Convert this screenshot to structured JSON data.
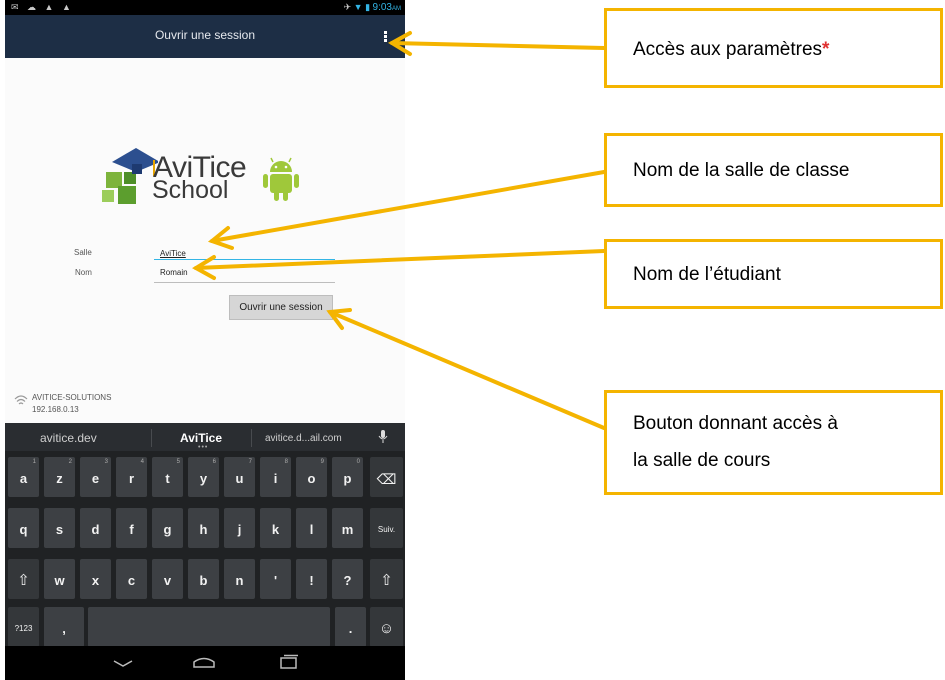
{
  "status_bar": {
    "time": "9:03",
    "ampm": "AM"
  },
  "action_bar": {
    "title": "Ouvrir une session"
  },
  "logo": {
    "line1": "AviTice",
    "line2": "School"
  },
  "form": {
    "salle_label": "Salle",
    "salle_value": "AviTice",
    "nom_label": "Nom",
    "nom_value": "Romain",
    "login_button": "Ouvrir une session"
  },
  "server": {
    "name": "AVITICE-SOLUTIONS",
    "ip": "192.168.0.13"
  },
  "keyboard": {
    "suggestions": [
      "avitice.dev",
      "AviTice",
      "avitice.d...ail.com"
    ],
    "row1": [
      [
        "a",
        "1"
      ],
      [
        "z",
        "2"
      ],
      [
        "e",
        "3"
      ],
      [
        "r",
        "4"
      ],
      [
        "t",
        "5"
      ],
      [
        "y",
        "6"
      ],
      [
        "u",
        "7"
      ],
      [
        "i",
        "8"
      ],
      [
        "o",
        "9"
      ],
      [
        "p",
        "0"
      ]
    ],
    "row2": [
      "q",
      "s",
      "d",
      "f",
      "g",
      "h",
      "j",
      "k",
      "l",
      "m"
    ],
    "row3": [
      "w",
      "x",
      "c",
      "v",
      "b",
      "n",
      "'",
      "!",
      "?"
    ],
    "next_key": "Suiv.",
    "symbols_key": "?123",
    "comma_key": ",",
    "period_key": "."
  },
  "callouts": {
    "settings": "Accès aux paramètres",
    "settings_mark": "*",
    "room": "Nom de la salle de classe",
    "student": "Nom de l’étudiant",
    "button_line1": "Bouton donnant accès à",
    "button_line2": "la salle de cours"
  },
  "colors": {
    "accent": "#f4b400",
    "action_bar": "#1d2e45",
    "input_focus": "#33b5e5",
    "asterisk": "#e03030",
    "keyboard_bg": "#202224"
  },
  "icons": [
    "signal-icon",
    "wifi-icon",
    "battery-icon",
    "overflow-menu-icon",
    "android-icon",
    "wifi-server-icon",
    "microphone-icon",
    "backspace-icon",
    "shift-icon",
    "emoji-icon",
    "back-nav-icon",
    "home-nav-icon",
    "recents-nav-icon"
  ]
}
